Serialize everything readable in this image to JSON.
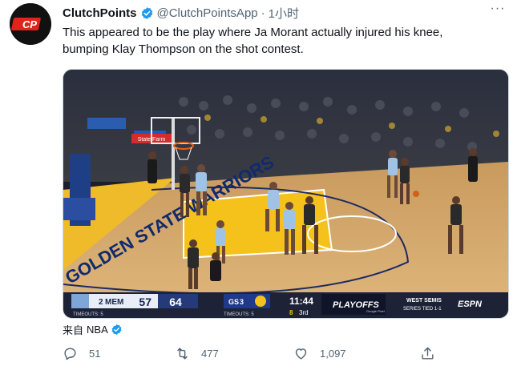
{
  "tweet": {
    "author_name": "ClutchPoints",
    "handle": "@ClutchPointsApp",
    "separator": "·",
    "time": "1小时",
    "text_line1": "This appeared to be the play where Ja Morant actually injured his knee,",
    "text_line2": "bumping Klay Thompson on the shot contest.",
    "more_label": "···",
    "avatar_text": "CP",
    "source_prefix": "来自",
    "source_name": "NBA",
    "reply_count": "51",
    "retweet_count": "477",
    "like_count": "1,097"
  },
  "video": {
    "scorebug": {
      "away_seed": "2",
      "away_team": "MEM",
      "away_score": "57",
      "home_score": "64",
      "home_seed": "GS",
      "home_seed_num": "3",
      "clock": "11:44",
      "shot_clock": "8",
      "quarter": "3rd",
      "timeouts_label": "TIMEOUTS: 5",
      "brand": "PLAYOFFS",
      "sponsor": "Google Pixel",
      "series_line1": "WEST SEMIS",
      "series_line2": "SERIES TIED 1-1",
      "network": "ESPN"
    },
    "court_text": "GOLDEN STATE WARRIORS",
    "banner_text": "PLAYOFFS",
    "sign_text": "State Farm"
  },
  "colors": {
    "verified": "#1d9bf0",
    "avatar_red": "#e0241c",
    "court_wood": "#d9b072",
    "paint_yellow": "#f5c21b",
    "scorebug_navy": "#18264a"
  }
}
